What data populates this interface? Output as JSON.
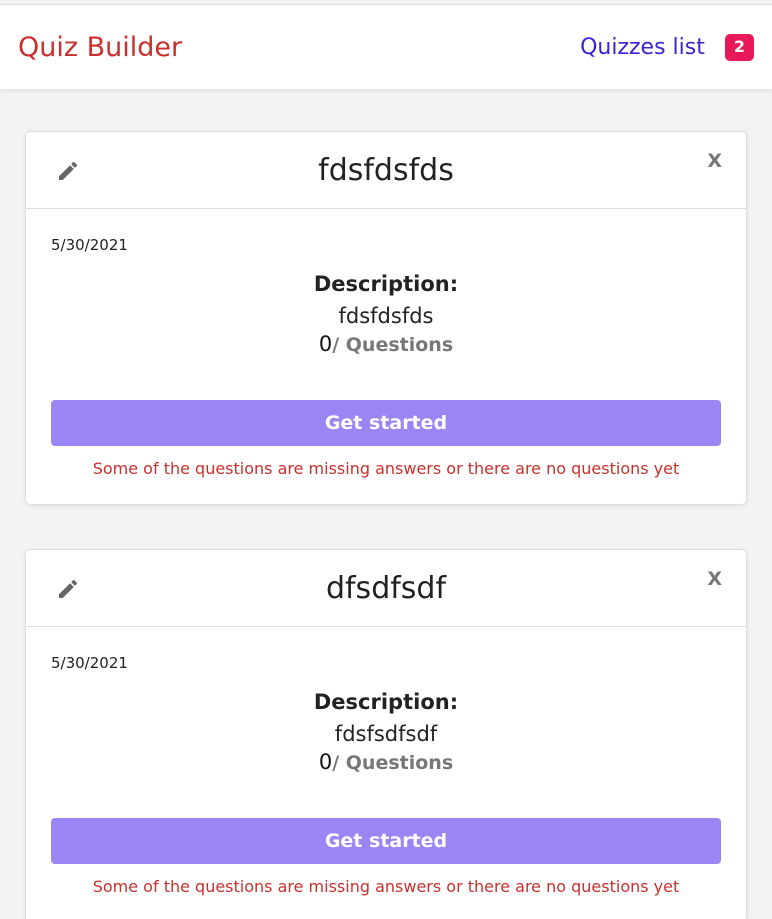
{
  "navbar": {
    "brand": "Quiz Builder",
    "quizzes_link": "Quizzes list",
    "badge_count": "2"
  },
  "quizzes": [
    {
      "title": "fdsfdsfds",
      "close_label": "X",
      "date": "5/30/2021",
      "description_label": "Description:",
      "description": "fdsfdsfds",
      "question_count": "0",
      "questions_label": "/ Questions",
      "button_label": "Get started",
      "warning": "Some of the questions are missing answers or there are no questions yet"
    },
    {
      "title": "dfsdfsdf",
      "close_label": "X",
      "date": "5/30/2021",
      "description_label": "Description:",
      "description": "fdsfsdfsdf",
      "question_count": "0",
      "questions_label": "/ Questions",
      "button_label": "Get started",
      "warning": "Some of the questions are missing answers or there are no questions yet"
    }
  ],
  "colors": {
    "brand": "#c9302c",
    "link": "#3a22d6",
    "badge": "#e8195a",
    "button": "#9b84f4",
    "warning": "#c9302c"
  },
  "icons": {
    "edit": "pencil-icon"
  }
}
